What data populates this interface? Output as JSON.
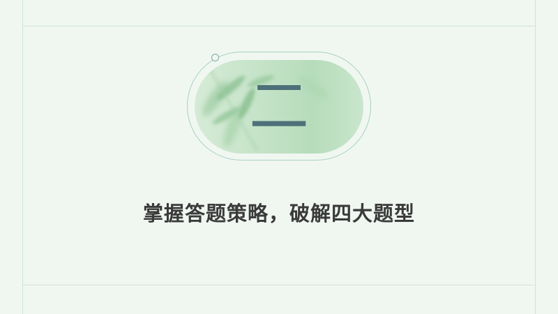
{
  "slide": {
    "section_numeral": "二",
    "subtitle": "掌握答题策略，破解四大题型"
  },
  "colors": {
    "background": "#f0f7f1",
    "frame_lines": "#cfe3da",
    "badge_outline": "#a8cfc2",
    "badge_fill": "#c4e3c7",
    "numeral": "#4e7079",
    "subtitle": "#3a3a3a"
  }
}
